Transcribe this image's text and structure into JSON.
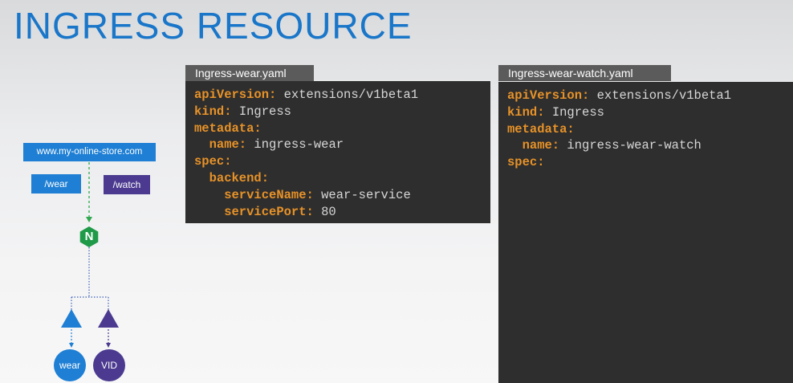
{
  "title": "INGRESS RESOURCE",
  "diagram": {
    "host": "www.my-online-store.com",
    "paths": {
      "wear": "/wear",
      "watch": "/watch"
    },
    "controller_label": "N",
    "services": {
      "wear": "wear",
      "vid": "VID"
    }
  },
  "file1": {
    "name": "Ingress-wear.yaml",
    "lines": [
      {
        "key": "apiVersion:",
        "value": " extensions/v1beta1"
      },
      {
        "key": "kind:",
        "value": " Ingress"
      },
      {
        "key": "metadata:",
        "value": ""
      },
      {
        "key": "  name:",
        "value": " ingress-wear"
      },
      {
        "key": "spec:",
        "value": ""
      },
      {
        "key": "  backend:",
        "value": ""
      },
      {
        "key": "    serviceName:",
        "value": " wear-service"
      },
      {
        "key": "    servicePort:",
        "value": " 80"
      }
    ]
  },
  "file2": {
    "name": "Ingress-wear-watch.yaml",
    "lines": [
      {
        "key": "apiVersion:",
        "value": " extensions/v1beta1"
      },
      {
        "key": "kind:",
        "value": " Ingress"
      },
      {
        "key": "metadata:",
        "value": ""
      },
      {
        "key": "  name:",
        "value": " ingress-wear-watch"
      },
      {
        "key": "spec:",
        "value": ""
      }
    ]
  },
  "colors": {
    "title": "#1976c9",
    "key": "#e79228",
    "code_bg": "#2e2e2e",
    "wear": "#1e7fd4",
    "watch": "#4b3a8f",
    "nginx": "#1f9a48"
  }
}
